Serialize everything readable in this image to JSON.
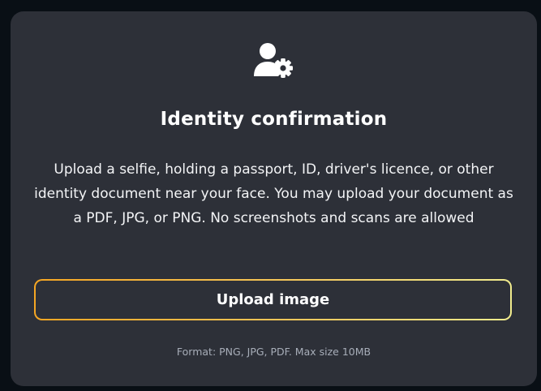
{
  "card": {
    "icon": "user-gear-icon",
    "title": "Identity confirmation",
    "description": "Upload a selfie, holding a passport, ID, driver's licence, or other identity document near your face. You may upload your document as a PDF, JPG, or PNG. No screenshots and scans are allowed",
    "upload_button_label": "Upload image",
    "format_note": "Format: PNG, JPG, PDF. Max size 10MB"
  },
  "colors": {
    "page_background": "#090f15",
    "card_background": "#2d3038",
    "button_border_gradient_start": "#f5a623",
    "button_border_gradient_end": "#f1ec8e",
    "text_primary": "#ffffff",
    "text_muted": "#a7adb8"
  }
}
